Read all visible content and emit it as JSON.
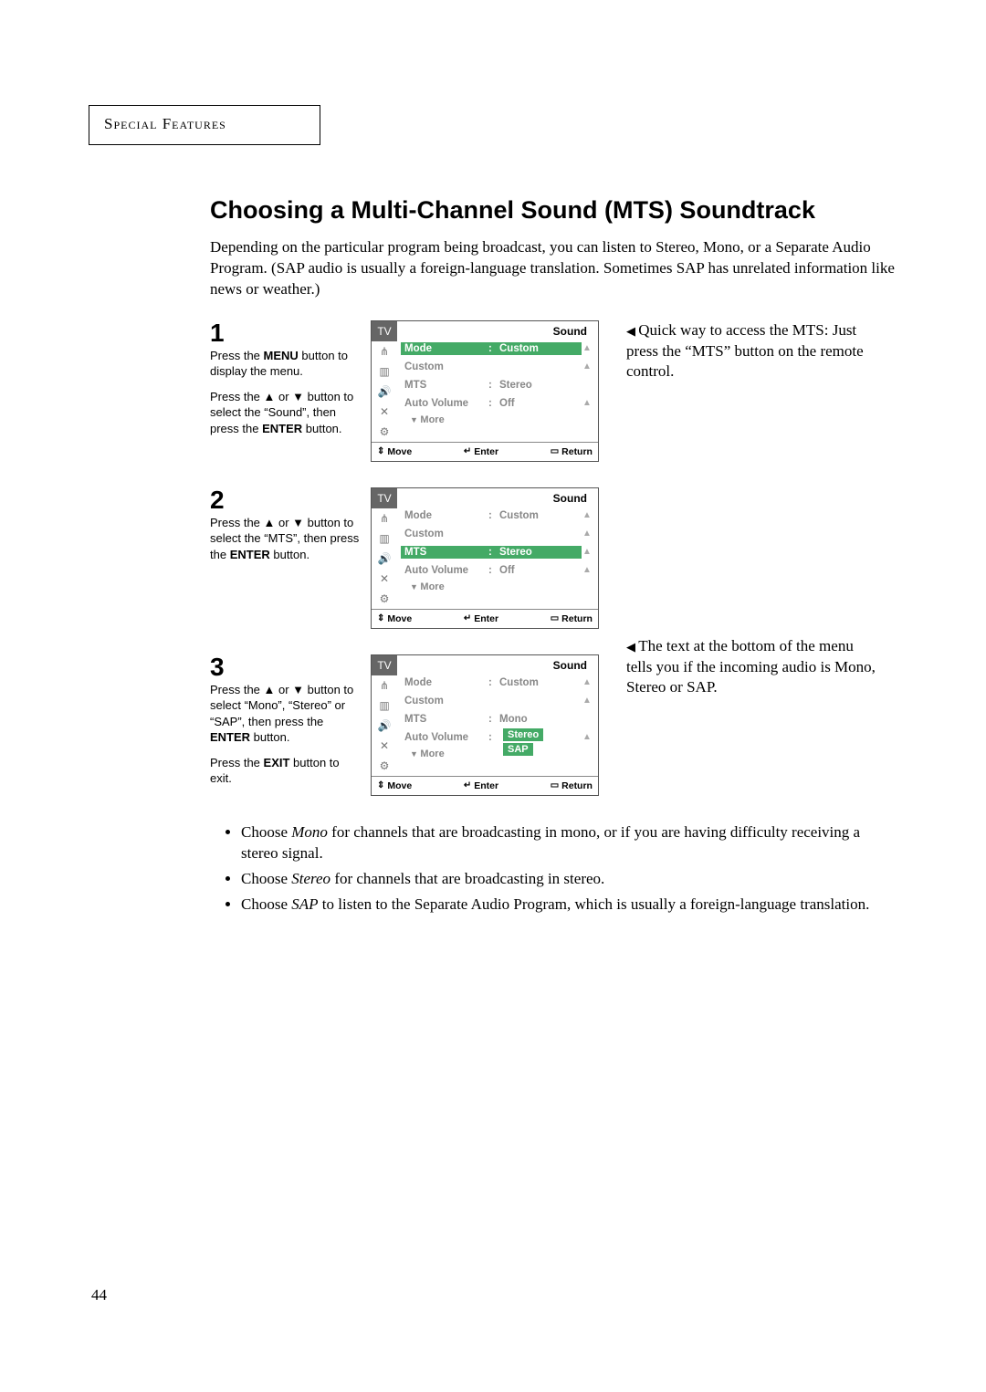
{
  "header": "Special Features",
  "title": "Choosing a Multi-Channel Sound (MTS) Soundtrack",
  "intro": "Depending on the particular program being broadcast, you can listen to Stereo, Mono, or a Separate Audio Program. (SAP audio is usually a foreign-language translation. Sometimes SAP has unrelated information like news or weather.)",
  "sidenote1a": "Quick way to access the MTS: Just press the “MTS” button on the remote control.",
  "sidenote3a": "The text at the bottom of the menu tells you if the incoming audio is Mono, Stereo or SAP.",
  "steps": {
    "s1": {
      "num": "1",
      "p1a": "Press the ",
      "p1b": "MENU",
      "p1c": " button to display the menu.",
      "p2a": "Press the ▲ or ▼ button to select the “Sound”, then press the ",
      "p2b": "ENTER",
      "p2c": " button."
    },
    "s2": {
      "num": "2",
      "p1a": "Press the ▲ or ▼ button to select the “MTS”, then press the ",
      "p1b": "ENTER",
      "p1c": " button."
    },
    "s3": {
      "num": "3",
      "p1a": "Press the ▲ or ▼ button to select “Mono”, “Stereo” or “SAP”, then press the ",
      "p1b": "ENTER",
      "p1c": " button.",
      "p2a": "Press the ",
      "p2b": "EXIT",
      "p2c": " button to exit."
    }
  },
  "osd": {
    "tv": "TV",
    "title": "Sound",
    "mode": "Mode",
    "custom": "Custom",
    "mts": "MTS",
    "stereo": "Stereo",
    "autovol": "Auto Volume",
    "off": "Off",
    "more": "More",
    "move": "Move",
    "enter": "Enter",
    "return": "Return",
    "mono": "Mono",
    "sap": "SAP"
  },
  "bullets": {
    "b1a": "Choose ",
    "b1i": "Mono",
    "b1b": " for channels that are broadcasting in mono, or if you are having difficulty receiving a stereo signal.",
    "b2a": "Choose ",
    "b2i": "Stereo",
    "b2b": " for channels that are broadcasting in stereo.",
    "b3a": "Choose ",
    "b3i": "SAP",
    "b3b": " to listen to the Separate Audio Program, which is usually a foreign-language translation."
  },
  "pagenum": "44"
}
